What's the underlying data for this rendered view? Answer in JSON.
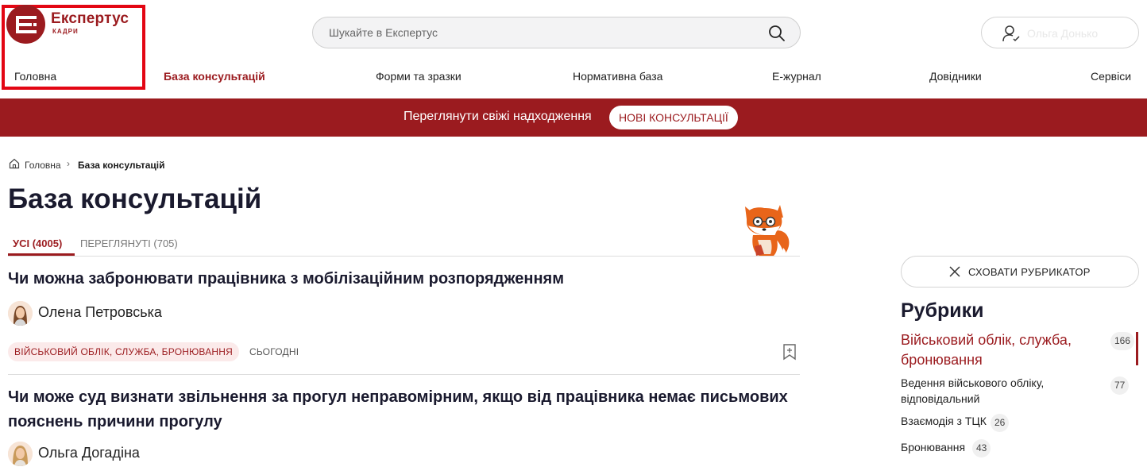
{
  "header": {
    "logo_word": "Експертус",
    "logo_sub": "КАДРИ",
    "search_placeholder": "Шукайте в Експертус",
    "account_name": "Ольга Донько"
  },
  "nav": [
    "Головна",
    "База консультацій",
    "Форми та зразки",
    "Нормативна база",
    "Е-журнал",
    "Довідники",
    "Сервіси"
  ],
  "banner": {
    "text": "Переглянути свіжі надходження",
    "button": "НОВІ КОНСУЛЬТАЦІЇ"
  },
  "breadcrumb": {
    "home": "Головна",
    "separator": "›",
    "current": "База консультацій"
  },
  "page_title": "База консультацій",
  "tabs": [
    "УСІ (4005)",
    "ПЕРЕГЛЯНУТІ (705)"
  ],
  "articles": [
    {
      "title": "Чи можна забронювати працівника з мобілізаційним розпорядженням",
      "author": "Олена Петровська",
      "tag": "ВІЙСЬКОВИЙ ОБЛІК, СЛУЖБА, БРОНЮВАННЯ",
      "date": "СЬОГОДНІ"
    },
    {
      "title": "Чи може суд визнати звільнення за прогул неправомірним, якщо від працівника немає письмових пояснень причини прогулу",
      "author": "Ольга Догадіна"
    }
  ],
  "rubricator": {
    "hide_label": "СХОВАТИ РУБРИКАТОР",
    "title": "Рубрики",
    "items": [
      {
        "label_line1": "Військовий облік, служба,",
        "label_line2": "бронювання",
        "count": "166"
      },
      {
        "label_line1": "Ведення військового обліку,",
        "label_line2": "відповідальний",
        "count": "77"
      },
      {
        "label": "Взаємодія з ТЦК",
        "count": "26"
      },
      {
        "label": "Бронювання",
        "count": "43"
      }
    ]
  },
  "colors": {
    "brand": "#9b1b1f",
    "highlight_frame": "#e30613",
    "tag_background": "#fbeaea"
  },
  "icons": [
    "logo-icon",
    "search-icon",
    "user-icon",
    "home-icon",
    "chevron-right-icon",
    "fox-mascot-icon",
    "bookmark-icon",
    "close-icon"
  ]
}
